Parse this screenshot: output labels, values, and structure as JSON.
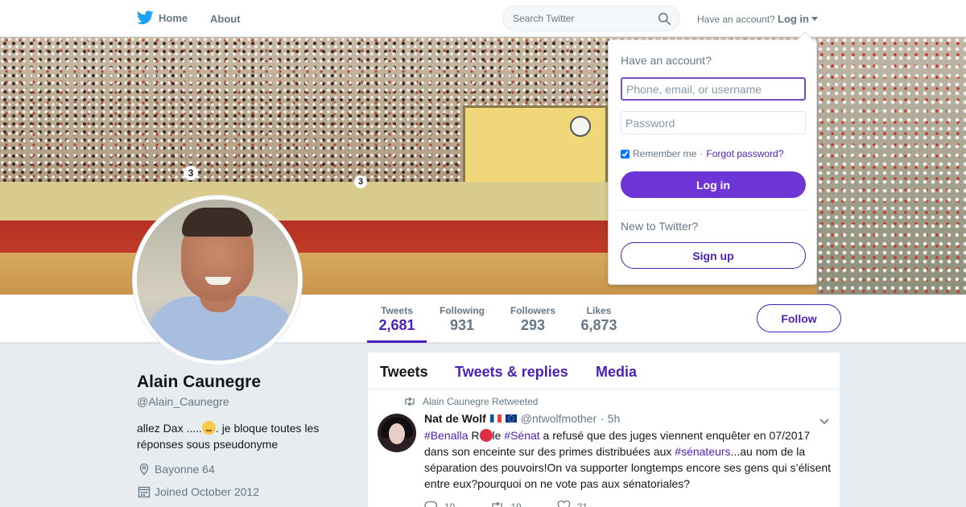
{
  "nav": {
    "home_label": "Home",
    "about_label": "About",
    "search_placeholder": "Search Twitter",
    "have_account": "Have an account?",
    "login_label": "Log in"
  },
  "login_dropdown": {
    "title": "Have an account?",
    "username_placeholder": "Phone, email, or username",
    "password_placeholder": "Password",
    "remember_label": "Remember me",
    "separator": "·",
    "forgot_label": "Forgot password?",
    "login_button": "Log in",
    "new_label": "New to Twitter?",
    "signup_button": "Sign up"
  },
  "banner": {
    "gate_number_1": "3",
    "gate_number_2": "3"
  },
  "profile": {
    "name": "Alain Caunegre",
    "handle": "@Alain_Caunegre",
    "bio_part1": "allez Dax .....",
    "bio_part2": ". je bloque toutes les réponses sous pseudonyme",
    "location": "Bayonne 64",
    "joined": "Joined October 2012"
  },
  "stats": [
    {
      "label": "Tweets",
      "value": "2,681",
      "active": true
    },
    {
      "label": "Following",
      "value": "931",
      "active": false
    },
    {
      "label": "Followers",
      "value": "293",
      "active": false
    },
    {
      "label": "Likes",
      "value": "6,873",
      "active": false
    }
  ],
  "follow_button": "Follow",
  "timeline": {
    "tabs": [
      "Tweets",
      "Tweets & replies",
      "Media"
    ],
    "tweet": {
      "retweeted_by": "Alain Caunegre Retweeted",
      "author_name": "Nat de Wolf",
      "author_handle": "@ntwolfmother",
      "time": "· 5h",
      "tag_benalla": "#Benalla",
      "text_r": " R",
      "text_le": "le ",
      "tag_senat": "#Sénat",
      "text_mid": " a refusé que des juges viennent enquêter en 07/2017 dans son enceinte sur des primes distribuées aux ",
      "tag_senateurs": "#sénateurs",
      "text_end": "...au nom de la séparation des pouvoirs!On va supporter longtemps encore ses gens qui s’élisent entre eux?pourquoi on ne vote pas aux sénatoriales?",
      "replies": "10",
      "retweets": "19",
      "likes": "21"
    }
  },
  "colors": {
    "accent": "#4b1fb8",
    "login_button": "#6e35d6",
    "background": "#e6ecf0"
  }
}
